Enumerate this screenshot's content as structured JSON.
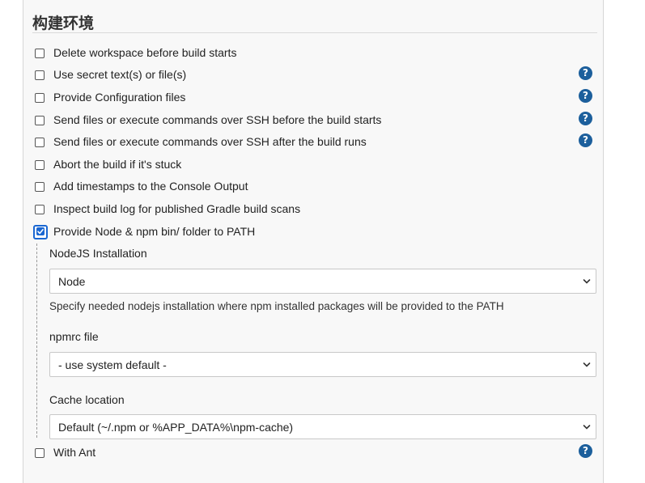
{
  "section": {
    "title": "构建环境"
  },
  "options": [
    {
      "label": "Delete workspace before build starts",
      "checked": false,
      "help": false
    },
    {
      "label": "Use secret text(s) or file(s)",
      "checked": false,
      "help": true
    },
    {
      "label": "Provide Configuration files",
      "checked": false,
      "help": true
    },
    {
      "label": "Send files or execute commands over SSH before the build starts",
      "checked": false,
      "help": true
    },
    {
      "label": "Send files or execute commands over SSH after the build runs",
      "checked": false,
      "help": true
    },
    {
      "label": "Abort the build if it's stuck",
      "checked": false,
      "help": false
    },
    {
      "label": "Add timestamps to the Console Output",
      "checked": false,
      "help": false
    },
    {
      "label": "Inspect build log for published Gradle build scans",
      "checked": false,
      "help": false
    },
    {
      "label": "Provide Node & npm bin/ folder to PATH",
      "checked": true,
      "help": false
    }
  ],
  "node": {
    "installation_label": "NodeJS Installation",
    "installation_value": "Node",
    "installation_desc": "Specify needed nodejs installation where npm installed packages will be provided to the PATH",
    "npmrc_label": "npmrc file",
    "npmrc_value": "- use system default -",
    "cache_label": "Cache location",
    "cache_value": "Default (~/.npm or %APP_DATA%\\npm-cache)"
  },
  "with_ant": {
    "label": "With Ant",
    "checked": false
  },
  "help_glyph": "?",
  "colors": {
    "accent": "#1a67d2",
    "help": "#1c5f9c"
  }
}
